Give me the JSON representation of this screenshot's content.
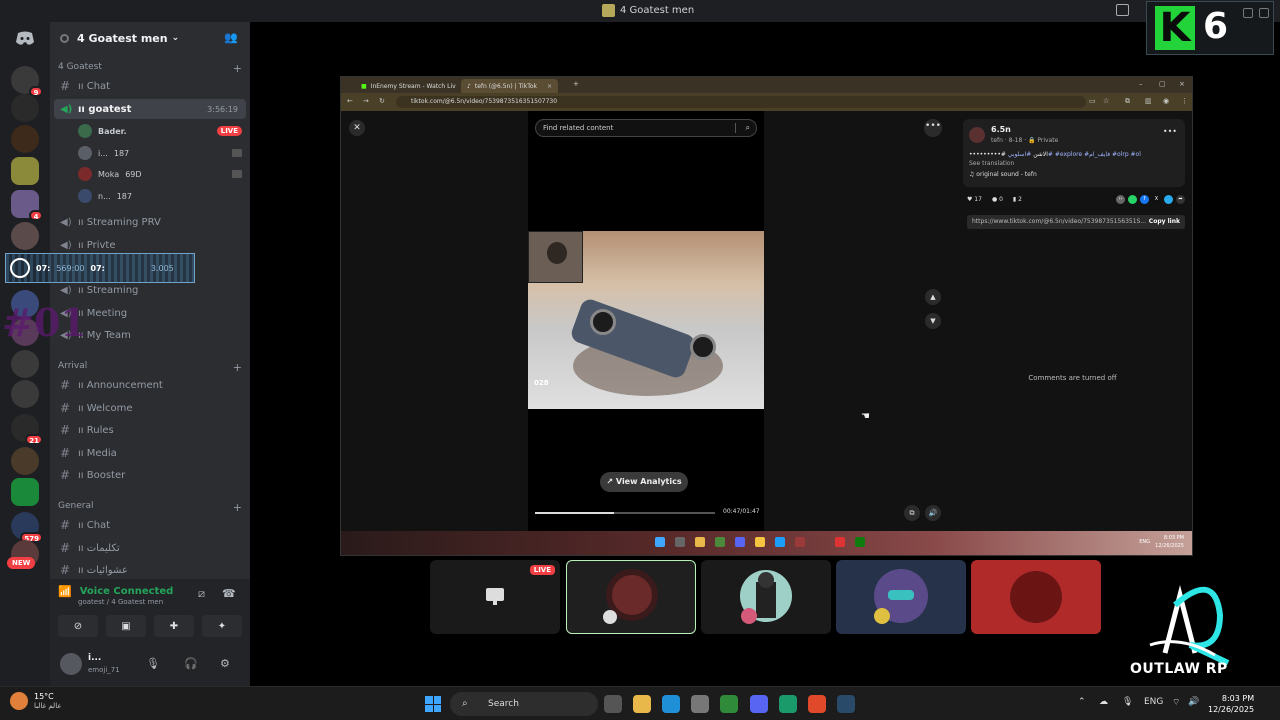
{
  "window": {
    "title": "4 Goatest men"
  },
  "server": {
    "name": "4 Goatest men"
  },
  "rail": {
    "badges": [
      "9",
      "4",
      "21",
      "579"
    ],
    "new_label": "NEW"
  },
  "categories": {
    "goatest": "4 Goatest",
    "arrival": "Arrival",
    "general": "General"
  },
  "channels": {
    "chat": "ıı Chat",
    "goatest": "ıı goatest",
    "goatest_time": "3:56:19",
    "streaming_prv": "ıı Streaming PRV",
    "privte": "ıı Privte",
    "streaming": "ıı Streaming",
    "meeting": "ıı Meeting",
    "my_team": "ıı My Team",
    "announcement": "ıı Announcement",
    "welcome": "ıı Welcome",
    "rules": "ıı Rules",
    "media": "ıı Media",
    "booster": "ıı Booster",
    "general_chat": "ıı Chat",
    "arabic1": "ıı تكليمات",
    "arabic2": "ıı عشوائيات"
  },
  "voice_users": [
    {
      "name": "Bader.",
      "live": "LIVE"
    },
    {
      "name": "i...",
      "count": "187"
    },
    {
      "name": "Moka",
      "count": "69D"
    },
    {
      "name": "n...",
      "count": "187"
    }
  ],
  "overlay": {
    "t1": "07:",
    "t1b": "569:00",
    "t2": "07:",
    "t2b": "3.005"
  },
  "watermark": "#01",
  "voice_panel": {
    "status": "Voice Connected",
    "location": "goatest / 4 Goatest men"
  },
  "user": {
    "name": "i...",
    "status": "emoji_71"
  },
  "browser": {
    "tab1": "InEnemy Stream - Watch Liv",
    "tab2": "tefn (@6.5n) | TikTok",
    "url": "tiktok.com/@6.5n/video/7539873516351507730"
  },
  "tiktok": {
    "search_placeholder": "Find related content",
    "game_num": "028",
    "analytics": "View Analytics",
    "time": "00:47/01:47",
    "progress": 0.44,
    "author": "6.5n",
    "meta": "tefn · 8-18 · 🔒 Private",
    "desc_prefix": "•••••••••# الاشن",
    "desc_tags": "#اسلوبي# #explore #فايف_ام #olrp #ol",
    "see_translation": "See translation",
    "sound": "♫  original sound - tefn",
    "likes": "17",
    "comments_count": "0",
    "saves": "2",
    "link": "https://www.tiktok.com/@6.5n/video/75398735156351S...",
    "copy": "Copy link",
    "comments_off": "Comments are turned off"
  },
  "inner_taskbar": {
    "eng": "ENG",
    "time": "8:03 PM",
    "date": "12/26/2025"
  },
  "tiles": {
    "live": "LIVE"
  },
  "logos": {
    "k6_letter": "K",
    "k6_num": "6",
    "outlaw": "OUTLAW RP"
  },
  "taskbar": {
    "temp": "15°C",
    "weather": "عالم غالبا",
    "search": "Search",
    "lang": "ENG",
    "time": "8:03 PM",
    "date": "12/26/2025"
  }
}
